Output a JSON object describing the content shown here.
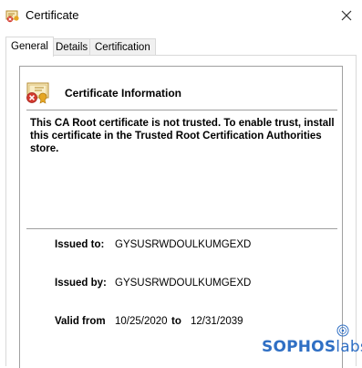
{
  "window": {
    "title": "Certificate",
    "app_icon": "certificate-error-icon",
    "close_icon": "close-icon"
  },
  "tabs": [
    {
      "label": "General",
      "active": true
    },
    {
      "label": "Details",
      "active": false
    },
    {
      "label": "Certification Path",
      "active": false
    }
  ],
  "general": {
    "header": "Certificate Information",
    "header_icon": "certificate-untrusted-icon",
    "message": "This CA Root certificate is not trusted. To enable trust, install this certificate in the Trusted Root Certification Authorities store.",
    "issued_to_label": "Issued to:",
    "issued_to_value": "GYSUSRWDOULKUMGEXD",
    "issued_by_label": "Issued by:",
    "issued_by_value": "GYSUSRWDOULKUMGEXD",
    "valid_from_label": "Valid from",
    "valid_from_value": "10/25/2020",
    "valid_to_label": "to",
    "valid_to_value": "12/31/2039"
  },
  "watermark": {
    "brand_bold": "SOPHOS",
    "brand_light": "labs",
    "logo_icon": "sophoslabs-logo-icon",
    "color": "#2f6fc4"
  }
}
